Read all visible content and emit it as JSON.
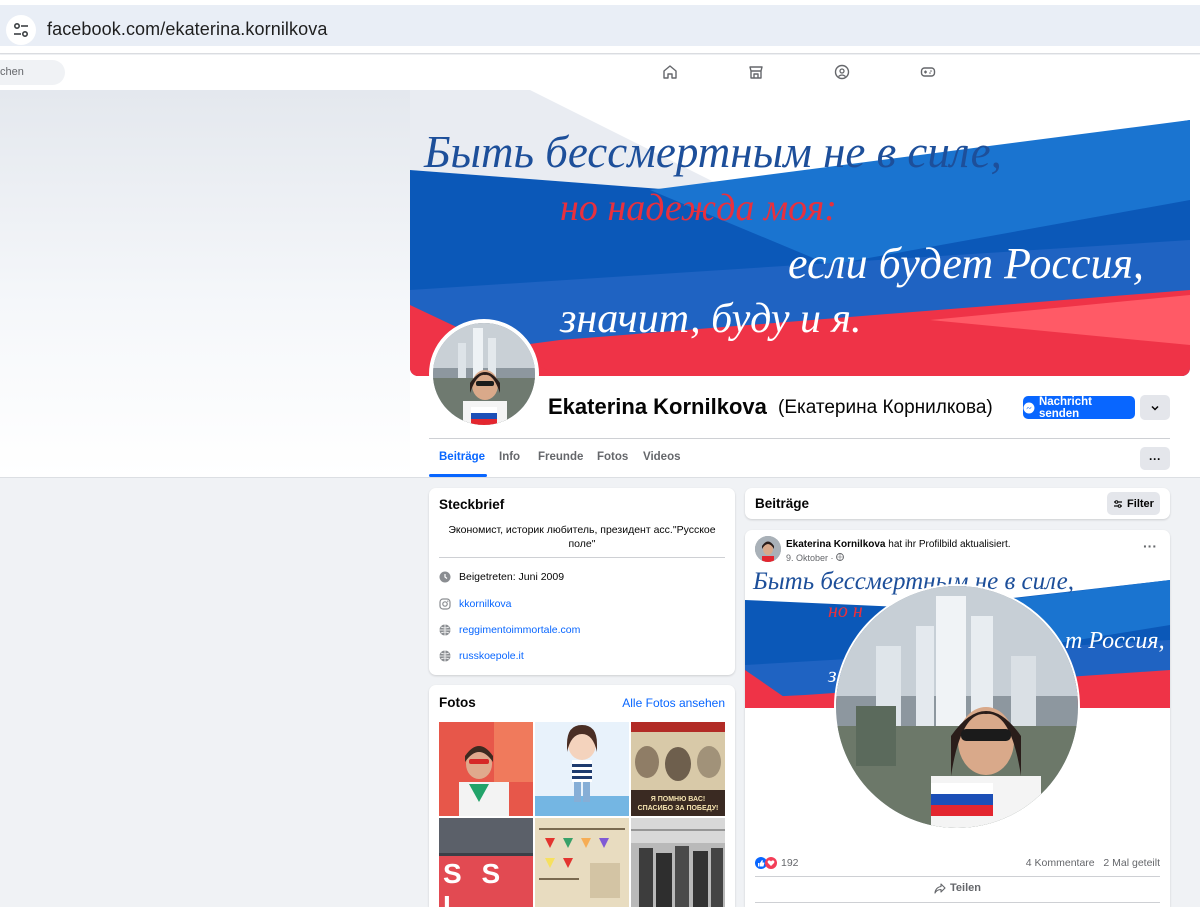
{
  "browser": {
    "url": "facebook.com/ekaterina.kornilkova"
  },
  "nav": {
    "search_placeholder": "chen",
    "icons": [
      "home-icon",
      "marketplace-icon",
      "groups-icon",
      "gaming-icon"
    ]
  },
  "cover": {
    "lines": [
      "Быть бессмертным не в силе,",
      "но надежда моя:",
      "если будет Россия,",
      "значит, буду и я."
    ]
  },
  "profile": {
    "name": "Ekaterina Kornilkova",
    "alt_name": "(Екатерина Корнилкова)",
    "message_button": "Nachricht senden"
  },
  "tabs": [
    "Beiträge",
    "Info",
    "Freunde",
    "Fotos",
    "Videos"
  ],
  "more_label": "···",
  "intro": {
    "title": "Steckbrief",
    "bio": "Экономист, историк любитель, президент асс.\"Русское поле\"",
    "joined": "Beigetreten: Juni 2009",
    "instagram": "kkornilkova",
    "websites": [
      "reggimentoimmortale.com",
      "russkoepole.it"
    ]
  },
  "photos": {
    "title": "Fotos",
    "see_all": "Alle Fotos ansehen",
    "captions": [
      "Я ПОМНЮ ВАС!",
      "СПАСИБО ЗА ПОБЕДУ!"
    ],
    "sign_letters": "S S I"
  },
  "posts": {
    "title": "Beiträge",
    "filter_label": "Filter",
    "items": [
      {
        "author": "Ekaterina Kornilkova",
        "action": "hat ihr Profilbild aktualisiert.",
        "date": "9. Oktober ·",
        "reaction_count": "192",
        "stats": "4 Kommentare   2 Mal geteilt",
        "share_label": "Teilen",
        "media_lines": [
          "Быть бессмертным не в силе,",
          "но н",
          "т Россия,",
          "з"
        ]
      }
    ]
  },
  "colors": {
    "fb_blue": "#0866ff",
    "flag_blue": "#0b58b8",
    "flag_red": "#e8303e",
    "text_dark": "#050505",
    "text_muted": "#65676b"
  }
}
